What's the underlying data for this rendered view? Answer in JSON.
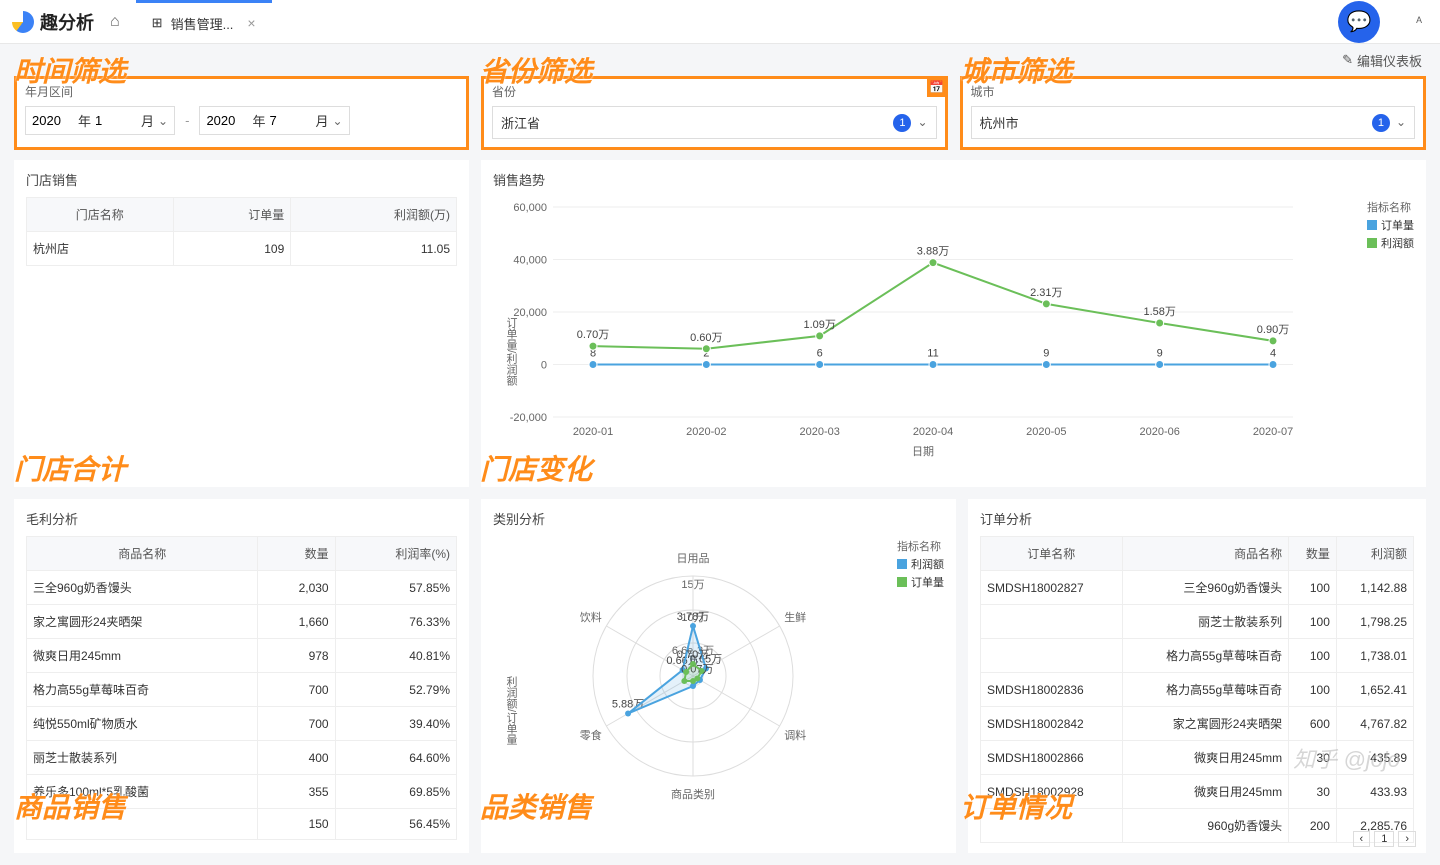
{
  "app": {
    "name": "趣分析",
    "tab": "销售管理...",
    "edit_dashboard": "编辑仪表板"
  },
  "annotations": {
    "time_filter": "时间筛选",
    "province_filter": "省份筛选",
    "city_filter": "城市筛选",
    "store_total": "门店合计",
    "store_change": "门店变化",
    "product_sales": "商品销售",
    "category_sales": "品类销售",
    "order_status": "订单情况"
  },
  "filters": {
    "date_label": "年月区间",
    "year1": "2020",
    "month1": "1",
    "year2": "2020",
    "month2": "7",
    "year_suffix": "年",
    "month_suffix": "月",
    "dash": "-",
    "province_label": "省份",
    "province_value": "浙江省",
    "province_count": "1",
    "city_label": "城市",
    "city_value": "杭州市",
    "city_count": "1"
  },
  "store_sales": {
    "title": "门店销售",
    "headers": [
      "门店名称",
      "订单量",
      "利润额(万)"
    ],
    "rows": [
      [
        "杭州店",
        "109",
        "11.05"
      ]
    ]
  },
  "trend": {
    "title": "销售趋势",
    "legend_title": "指标名称",
    "series_names": [
      "订单量",
      "利润额"
    ],
    "y_axis_label": "订单量/利润额",
    "x_axis_label": "日期"
  },
  "chart_data": {
    "trend": {
      "type": "line",
      "categories": [
        "2020-01",
        "2020-02",
        "2020-03",
        "2020-04",
        "2020-05",
        "2020-06",
        "2020-07"
      ],
      "ylim": [
        -20000,
        60000
      ],
      "series": [
        {
          "name": "订单量",
          "values": [
            8,
            2,
            6,
            11,
            9,
            9,
            4
          ],
          "labels": [
            "8",
            "2",
            "6",
            "11",
            "9",
            "9",
            "4"
          ],
          "color": "#4aa3df"
        },
        {
          "name": "利润额",
          "values": [
            7000,
            6000,
            10900,
            38800,
            23100,
            15800,
            9000
          ],
          "labels": [
            "0.70万",
            "0.60万",
            "1.09万",
            "3.88万",
            "2.31万",
            "1.58万",
            "0.90万"
          ],
          "color": "#6bbf59"
        }
      ]
    },
    "radar": {
      "type": "radar",
      "categories": [
        "日用品",
        "生鲜",
        "调料",
        "商品类别",
        "零食",
        "饮料"
      ],
      "rings": [
        "15万",
        "10万",
        "6.6e-3万"
      ],
      "series": [
        {
          "name": "利润额",
          "color": "#4aa3df",
          "labels": [
            "3.78万",
            "0.65万",
            "",
            "",
            "5.88万",
            "0.66万"
          ]
        },
        {
          "name": "订单量",
          "color": "#6bbf59",
          "labels": [
            "0.70万",
            "",
            "0.07万",
            "",
            "",
            ""
          ]
        }
      ]
    }
  },
  "profit": {
    "title": "毛利分析",
    "headers": [
      "商品名称",
      "数量",
      "利润率(%)"
    ],
    "rows": [
      [
        "三全960g奶香馒头",
        "2,030",
        "57.85%"
      ],
      [
        "家之寓圆形24夹晒架",
        "1,660",
        "76.33%"
      ],
      [
        "微爽日用245mm",
        "978",
        "40.81%"
      ],
      [
        "格力高55g草莓味百奇",
        "700",
        "52.79%"
      ],
      [
        "纯悦550ml矿物质水",
        "700",
        "39.40%"
      ],
      [
        "丽芝士散装系列",
        "400",
        "64.60%"
      ],
      [
        "养乐多100ml*5乳酸菌",
        "355",
        "69.85%"
      ],
      [
        "",
        "150",
        "56.45%"
      ]
    ]
  },
  "category": {
    "title": "类别分析",
    "legend_title": "指标名称",
    "y_axis_label": "利润额/订单量"
  },
  "orders": {
    "title": "订单分析",
    "headers": [
      "订单名称",
      "商品名称",
      "数量",
      "利润额"
    ],
    "rows": [
      [
        "SMDSH18002827",
        "三全960g奶香馒头",
        "100",
        "1,142.88"
      ],
      [
        "",
        "丽芝士散装系列",
        "100",
        "1,798.25"
      ],
      [
        "",
        "格力高55g草莓味百奇",
        "100",
        "1,738.01"
      ],
      [
        "SMDSH18002836",
        "格力高55g草莓味百奇",
        "100",
        "1,652.41"
      ],
      [
        "SMDSH18002842",
        "家之寓圆形24夹晒架",
        "600",
        "4,767.82"
      ],
      [
        "SMDSH18002866",
        "微爽日用245mm",
        "30",
        "435.89"
      ],
      [
        "SMDSH18002928",
        "微爽日用245mm",
        "30",
        "433.93"
      ],
      [
        "",
        "960g奶香馒头",
        "200",
        "2,285.76"
      ]
    ],
    "page": "1"
  },
  "watermark": "知乎 @jojo"
}
